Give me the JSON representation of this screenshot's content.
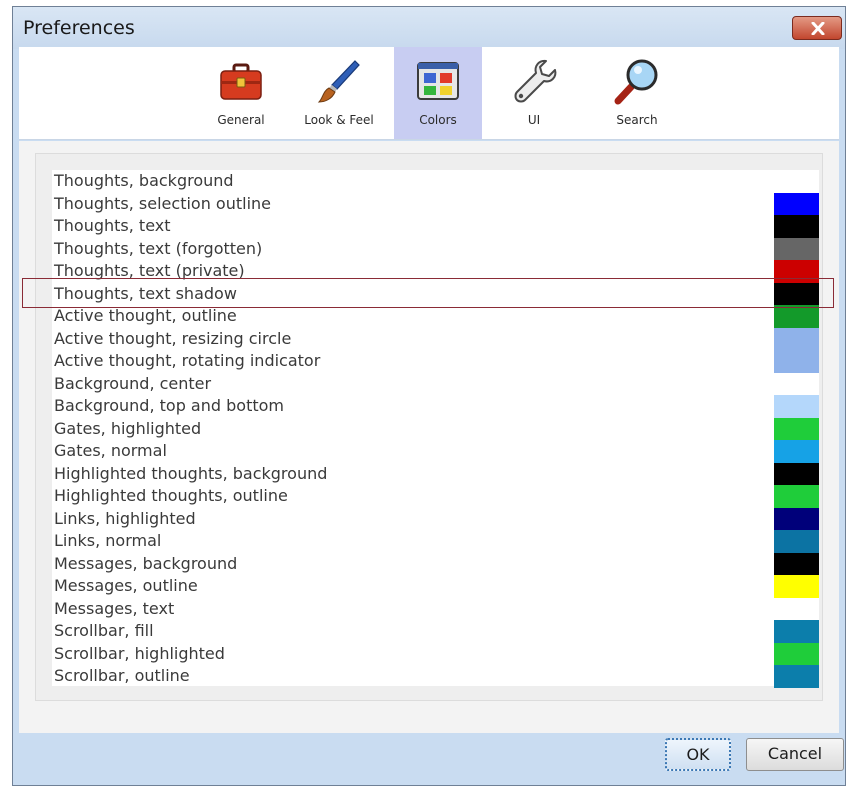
{
  "window": {
    "title": "Preferences"
  },
  "tabs": [
    {
      "label": "General",
      "icon": "toolbox-icon",
      "selected": false
    },
    {
      "label": "Look & Feel",
      "icon": "paintbrush-icon",
      "selected": false
    },
    {
      "label": "Colors",
      "icon": "color-palette-icon",
      "selected": true
    },
    {
      "label": "UI",
      "icon": "wrench-icon",
      "selected": false
    },
    {
      "label": "Search",
      "icon": "magnifier-icon",
      "selected": false
    }
  ],
  "color_settings": [
    {
      "label": "Thoughts, background",
      "color": "#ffffff"
    },
    {
      "label": "Thoughts, selection outline",
      "color": "#0000ff"
    },
    {
      "label": "Thoughts, text",
      "color": "#000000"
    },
    {
      "label": "Thoughts, text (forgotten)",
      "color": "#666666"
    },
    {
      "label": "Thoughts, text (private)",
      "color": "#cc0000"
    },
    {
      "label": "Thoughts, text shadow",
      "color": "#000000"
    },
    {
      "label": "Active thought, outline",
      "color": "#139a2a"
    },
    {
      "label": "Active thought, resizing circle",
      "color": "#8fb2ea"
    },
    {
      "label": "Active thought, rotating indicator",
      "color": "#8fb2ea"
    },
    {
      "label": "Background, center",
      "color": "#ffffff"
    },
    {
      "label": "Background, top and bottom",
      "color": "#b4d7fb"
    },
    {
      "label": "Gates, highlighted",
      "color": "#1fcd3a"
    },
    {
      "label": "Gates, normal",
      "color": "#16a2e6"
    },
    {
      "label": "Highlighted thoughts, background",
      "color": "#000000"
    },
    {
      "label": "Highlighted thoughts, outline",
      "color": "#1fcd3a"
    },
    {
      "label": "Links, highlighted",
      "color": "#00007a"
    },
    {
      "label": "Links, normal",
      "color": "#0c73a3"
    },
    {
      "label": "Messages, background",
      "color": "#000000"
    },
    {
      "label": "Messages, outline",
      "color": "#ffff00"
    },
    {
      "label": "Messages, text",
      "color": "#ffffff"
    },
    {
      "label": "Scrollbar, fill",
      "color": "#0c7eab"
    },
    {
      "label": "Scrollbar, highlighted",
      "color": "#1fcd3a"
    },
    {
      "label": "Scrollbar, outline",
      "color": "#0c7eab"
    }
  ],
  "highlighted_row_label": "Thoughts, text shadow",
  "footer": {
    "ok_label": "OK",
    "cancel_label": "Cancel"
  }
}
